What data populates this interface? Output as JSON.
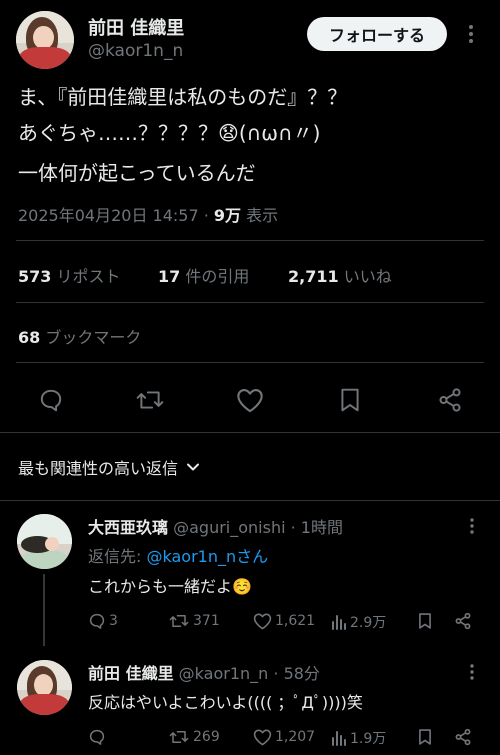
{
  "post": {
    "author_name": "前田 佳織里",
    "author_handle": "@kaor1n_n",
    "follow_label": "フォローする",
    "more_label": "⋮",
    "text_lines": [
      "ま、『前田佳織里は私のものだ』？？",
      "あぐちゃ……？？？？😧(∩ω∩〃)",
      "一体何が起こっているんだ"
    ],
    "timestamp": "2025年04月20日 14:57",
    "separator": "·",
    "views_count": "9万",
    "views_label": "表示"
  },
  "stats": {
    "reposts_count": "573",
    "reposts_label": "リポスト",
    "quotes_count": "17",
    "quotes_label": "件の引用",
    "likes_count": "2,711",
    "likes_label": "いいね",
    "bookmarks_count": "68",
    "bookmarks_label": "ブックマーク"
  },
  "sort": {
    "label": "最も関連性の高い返信"
  },
  "replies": [
    {
      "author_name": "大西亜玖璃",
      "author_handle": "@aguri_onishi",
      "time": "· 1時間",
      "reply_to_prefix": "返信先: ",
      "reply_to_handle": "@kaor1n_nさん",
      "text": "これからも一緒だよ☺️",
      "replies_count": "3",
      "reposts_count": "371",
      "likes_count": "1,621",
      "views_count": "2.9万"
    },
    {
      "author_name": "前田 佳織里",
      "author_handle": "@kaor1n_n",
      "time": "· 58分",
      "text": "反応はやいよこわいよ(((( ；ﾟДﾟ))))笑",
      "reposts_count": "269",
      "likes_count": "1,207",
      "views_count": "1.9万"
    }
  ],
  "icons": [
    "more-icon",
    "reply-icon",
    "repost-icon",
    "like-icon",
    "bookmark-icon",
    "share-icon",
    "chevron-down-icon",
    "views-icon"
  ]
}
